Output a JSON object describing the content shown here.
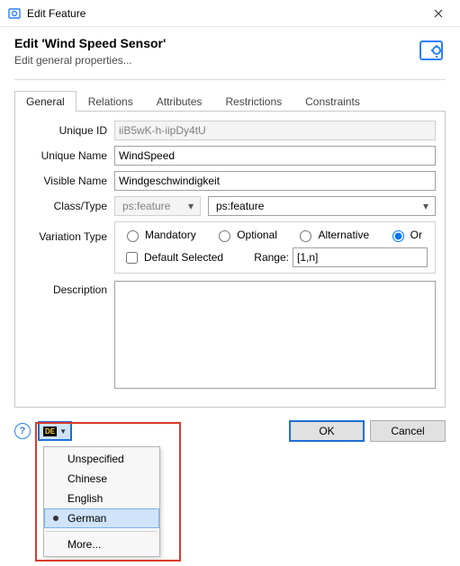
{
  "window": {
    "title": "Edit Feature"
  },
  "header": {
    "title": "Edit 'Wind Speed Sensor'",
    "subtitle": "Edit general properties..."
  },
  "tabs": {
    "general": "General",
    "relations": "Relations",
    "attributes": "Attributes",
    "restrictions": "Restrictions",
    "constraints": "Constraints"
  },
  "form": {
    "unique_id_label": "Unique ID",
    "unique_id_value": "iiB5wK-h-iipDy4tU",
    "unique_name_label": "Unique Name",
    "unique_name_value": "WindSpeed",
    "visible_name_label": "Visible Name",
    "visible_name_value": "Windgeschwindigkeit",
    "class_type_label": "Class/Type",
    "class_type_left": "ps:feature",
    "class_type_right": "ps:feature",
    "variation_label": "Variation Type",
    "variation": {
      "opt_mandatory": "Mandatory",
      "opt_optional": "Optional",
      "opt_alternative": "Alternative",
      "opt_or": "Or",
      "selected": "or",
      "default_selected_label": "Default Selected",
      "range_label": "Range:",
      "range_value": "[1,n]"
    },
    "description_label": "Description",
    "description_value": ""
  },
  "footer": {
    "lang_code": "DE",
    "ok": "OK",
    "cancel": "Cancel"
  },
  "lang_menu": {
    "unspecified": "Unspecified",
    "chinese": "Chinese",
    "english": "English",
    "german": "German",
    "more": "More..."
  }
}
